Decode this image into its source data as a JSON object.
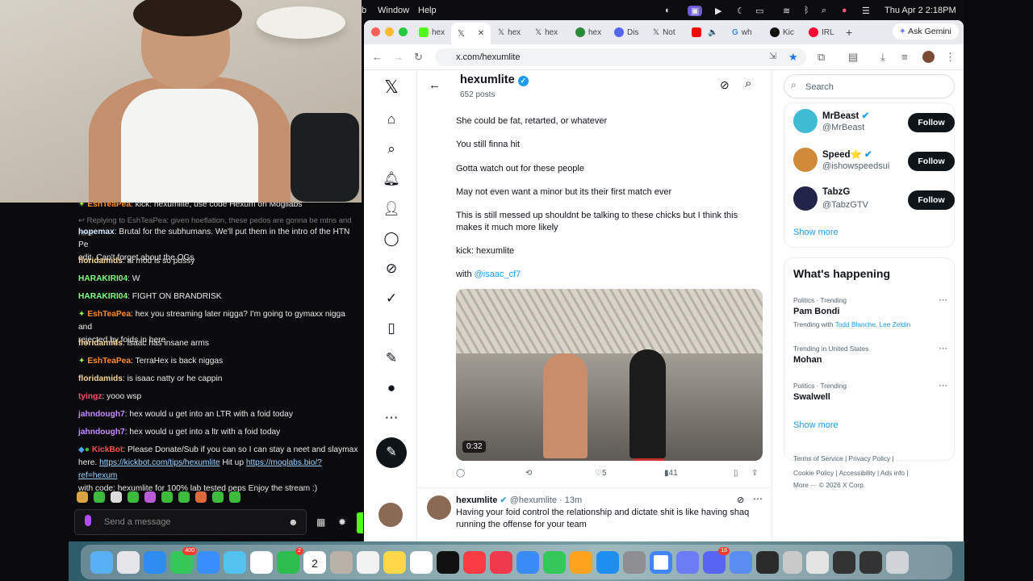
{
  "menubar": {
    "window": "Window",
    "help": "Help",
    "clock": "Thu Apr 2  2:18PM",
    "left_char": "b"
  },
  "browser": {
    "tabs": [
      "hex",
      "",
      "hex",
      "hex",
      "hex",
      "Dis",
      "Not",
      "",
      "wh",
      "Kic",
      "IRL"
    ],
    "ask_gemini": "Ask Gemini",
    "url": "x.com/hexumlite"
  },
  "chat": {
    "messages": [
      {
        "user": "EshTeaPea",
        "text": ": kick: hexumlite, use code Hexum on Mogilabs",
        "color": "#ff8c2a"
      },
      {
        "reply": "Replying to EshTeaPea: given hoeflation, these pedos are gonna be mtns and htns"
      },
      {
        "user": "hopemax",
        "text": ": Brutal for the subhumans. We'll put them in the intro of the HTN Pe",
        "text2": "edit. Can't forget about the OGs",
        "color": "#cfe6ff"
      },
      {
        "user": "floridamids",
        "text": ": ai mod is so pussy",
        "color": "#f5d59a"
      },
      {
        "user": "HARAKIRI04",
        "text": ": W",
        "color": "#7dff7d"
      },
      {
        "user": "HARAKIRI04",
        "text": ": FIGHT ON BRANDRISK",
        "color": "#7dff7d"
      },
      {
        "user": "EshTeaPea",
        "text": ": hex you streaming later nigga? I'm going to gymaxx nigga and",
        "text2": "rejected by foids in here",
        "color": "#ff8c2a"
      },
      {
        "user": "floridamids",
        "text": ": isaac has insane arms",
        "color": "#f5d59a"
      },
      {
        "user": "EshTeaPea",
        "text": ": TerraHex is back niggas",
        "color": "#ff8c2a"
      },
      {
        "user": "floridamids",
        "text": ": is isaac natty or he cappin",
        "color": "#f5d59a"
      },
      {
        "user": "tyingz",
        "text": ": yooo wsp",
        "color": "#ff4d6d"
      },
      {
        "user": "jahndough7",
        "text": ": hex would u get into an LTR with a foid today",
        "color": "#c68bff"
      },
      {
        "user": "jahndough7",
        "text": ": hex would u get into a ltr with a foid today",
        "color": "#c68bff"
      },
      {
        "user": "KickBot",
        "text": ": Please Donate/Sub if you can so I can stay a neet and slaymax",
        "color": "#ff4d4d"
      }
    ],
    "kickbot_line2_a": "here. ",
    "kickbot_link1": "https://kickbot.com/tips/hexumlite",
    "kickbot_line2_b": " Hit up ",
    "kickbot_link2": "https://moglabs.bio/?ref=hexum",
    "kickbot_line3": "with code: hexumlite for 100% lab tested peps Enjoy the stream :)",
    "placeholder": "Send a message"
  },
  "profile": {
    "name": "hexumlite",
    "posts": "652 posts"
  },
  "tweet": {
    "lines": [
      "She could be fat, retarted, or whatever",
      "You still finna hit",
      "Gotta watch out for these people",
      "May not even want a minor but its their first match ever",
      "This is still messed up shouldnt be talking to these chicks but I think this makes it much more likely",
      "kick: hexumlite"
    ],
    "with": "with ",
    "mention": "@isaac_cf7",
    "duration": "0:32",
    "likes": "5",
    "views": "41"
  },
  "next_tweet": {
    "name": "hexumlite",
    "handle": "@hexumlite · 13m",
    "text": "Having your foid control the relationship and dictate shit is like having shaq running the offense for your team"
  },
  "right": {
    "search": "Search",
    "follow_label": "Follow",
    "who": [
      {
        "name": "MrBeast",
        "handle": "@MrBeast"
      },
      {
        "name": "Speed⭐",
        "handle": "@ishowspeedsui"
      },
      {
        "name": "TabzG",
        "handle": "@TabzGTV"
      }
    ],
    "show_more": "Show more",
    "happening_title": "What's happening",
    "trends": [
      {
        "meta": "Politics · Trending",
        "name": "Pam Bondi",
        "sub": "Trending with ",
        "links": "Todd Blanche, Lee Zeldin"
      },
      {
        "meta": "Trending in United States",
        "name": "Mohan"
      },
      {
        "meta": "Politics · Trending",
        "name": "Swalwell"
      }
    ],
    "footer1": "Terms of Service  |  Privacy Policy  |",
    "footer2": "Cookie Policy  |  Accessibility  |  Ads info  |",
    "footer3": "More ···   © 2026 X Corp."
  },
  "dock_badges": [
    "400",
    "2",
    "18"
  ],
  "dock_date": "2"
}
